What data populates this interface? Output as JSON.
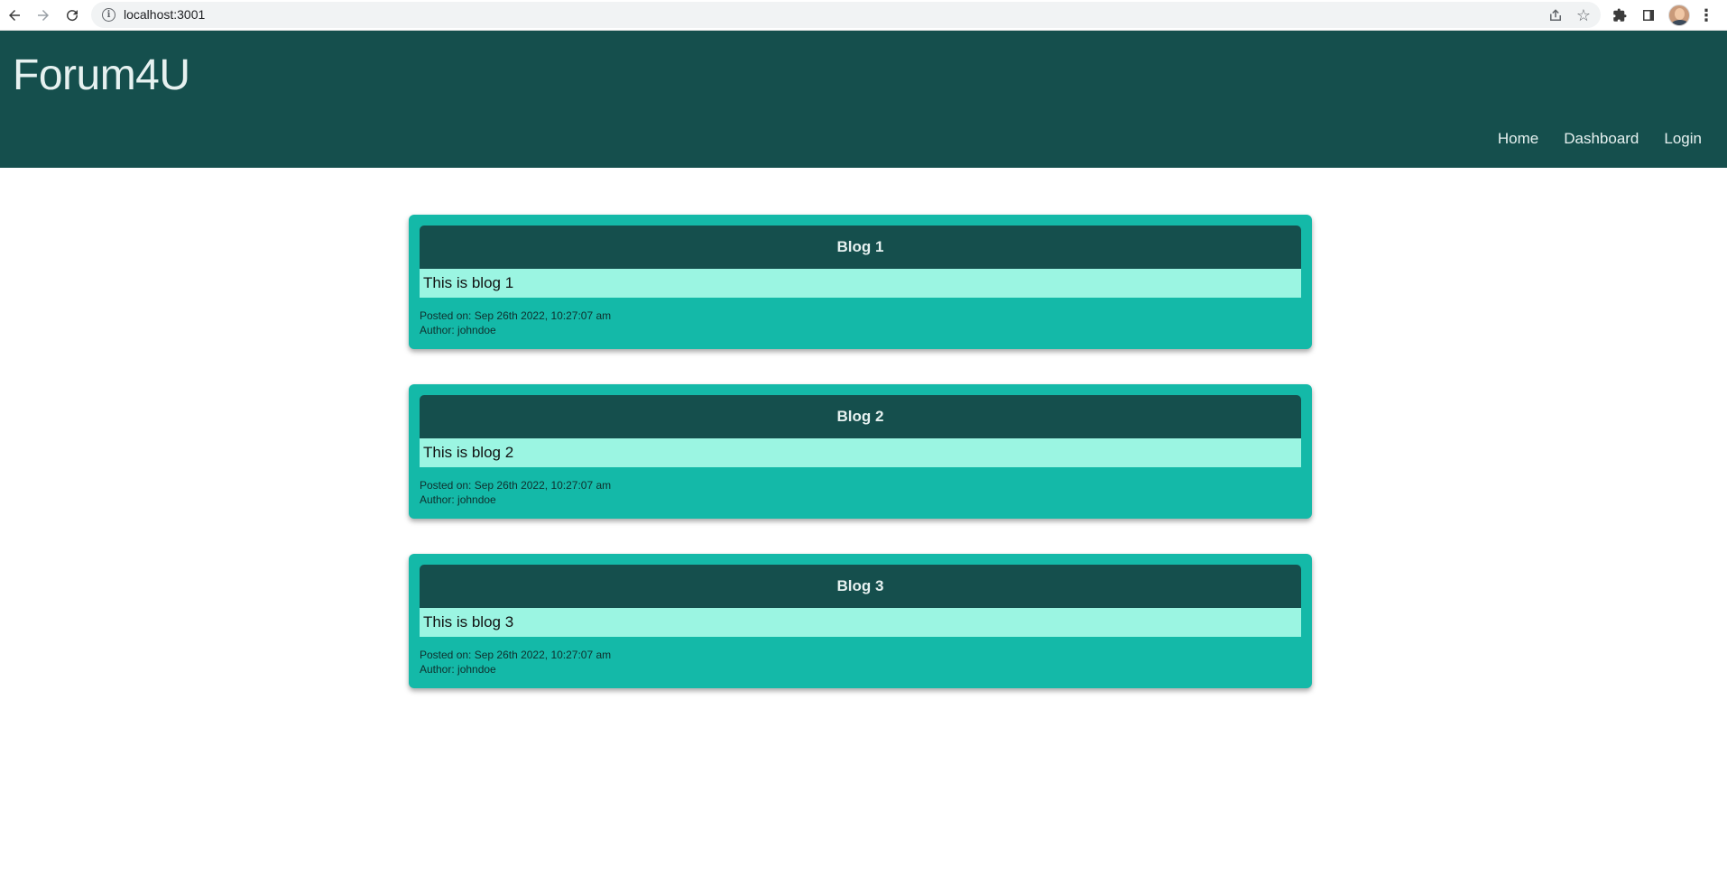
{
  "browser": {
    "url": "localhost:3001"
  },
  "site": {
    "brand": "Forum4U",
    "nav": [
      {
        "label": "Home"
      },
      {
        "label": "Dashboard"
      },
      {
        "label": "Login"
      }
    ]
  },
  "colors": {
    "header_bg": "#154f4d",
    "card_bg": "#14b9a8",
    "card_body_bg": "#9bf5e2"
  },
  "blogs": [
    {
      "title": "Blog 1",
      "content": "This is blog 1",
      "posted": "Posted on: Sep 26th 2022, 10:27:07 am",
      "author": "Author: johndoe"
    },
    {
      "title": "Blog 2",
      "content": "This is blog 2",
      "posted": "Posted on: Sep 26th 2022, 10:27:07 am",
      "author": "Author: johndoe"
    },
    {
      "title": "Blog 3",
      "content": "This is blog 3",
      "posted": "Posted on: Sep 26th 2022, 10:27:07 am",
      "author": "Author: johndoe"
    }
  ]
}
